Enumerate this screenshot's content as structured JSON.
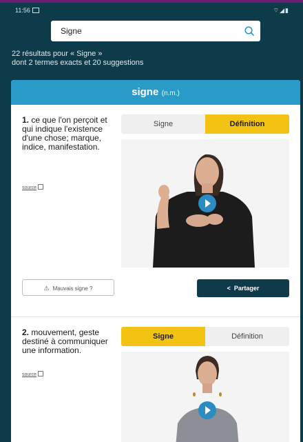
{
  "status_bar": {
    "time": "11:56",
    "icons": "⌔◢▮"
  },
  "search": {
    "value": "Signe",
    "placeholder": ""
  },
  "summary": {
    "line1": "22 résultats pour « Signe »",
    "line2": "dont 2 termes exacts et 20 suggestions"
  },
  "result": {
    "headword": "signe",
    "pos": "(n.m.)",
    "entries": [
      {
        "number": "1.",
        "definition": "ce que l'on perçoit et qui indique l'existence d'une chose; marque, indice, manifestation.",
        "source_label": "source",
        "tabs": [
          {
            "label": "Signe",
            "active": false
          },
          {
            "label": "Définition",
            "active": true
          }
        ],
        "report_label": "Mauvais signe ?",
        "share_label": "Partager"
      },
      {
        "number": "2.",
        "definition": "mouvement, geste destiné à communiquer une information.",
        "source_label": "source",
        "tabs": [
          {
            "label": "Signe",
            "active": true
          },
          {
            "label": "Définition",
            "active": false
          }
        ]
      }
    ]
  },
  "colors": {
    "background": "#0e3b4a",
    "header": "#2a9ac9",
    "active_tab": "#f2c313",
    "share_button": "#0f3a4a",
    "play_button": "#2b8cc4"
  }
}
